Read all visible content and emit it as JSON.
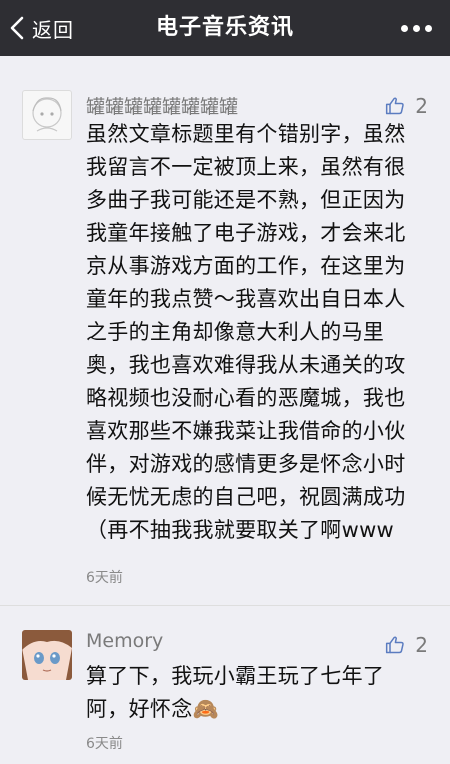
{
  "nav": {
    "back_label": "返回",
    "title": "电子音乐资讯"
  },
  "comments": [
    {
      "nickname": "罐罐罐罐罐罐罐罐",
      "likes": "2",
      "lines": [
        "虽然文章标题里有个错别字，虽然",
        "我留言不一定被顶上来，虽然有很",
        "多曲子我可能还是不熟，但正因为",
        "我童年接触了电子游戏，才会来北",
        "京从事游戏方面的工作，在这里为",
        "童年的我点赞～我喜欢出自日本人",
        "之手的主角却像意大利人的马里",
        "奥，我也喜欢难得我从未通关的攻",
        "略视频也没耐心看的恶魔城，我也",
        "喜欢那些不嫌我菜让我借命的小伙",
        "伴，对游戏的感情更多是怀念小时",
        "候无忧无虑的自己吧，祝圆满成功",
        "（再不抽我我就要取关了啊www"
      ],
      "time": "6天前"
    },
    {
      "nickname": "Memory",
      "likes": "2",
      "lines": [
        "算了下，我玩小霸王玩了七年了",
        "阿，好怀念🙈"
      ],
      "time": "6天前"
    }
  ],
  "colors": {
    "nav_bg": "#2e2e33",
    "page_bg": "#efeff4",
    "like_icon": "#5b7cc0"
  },
  "icons": {
    "back": "chevron-left-icon",
    "more": "more-dots-icon",
    "like": "thumbs-up-icon"
  }
}
